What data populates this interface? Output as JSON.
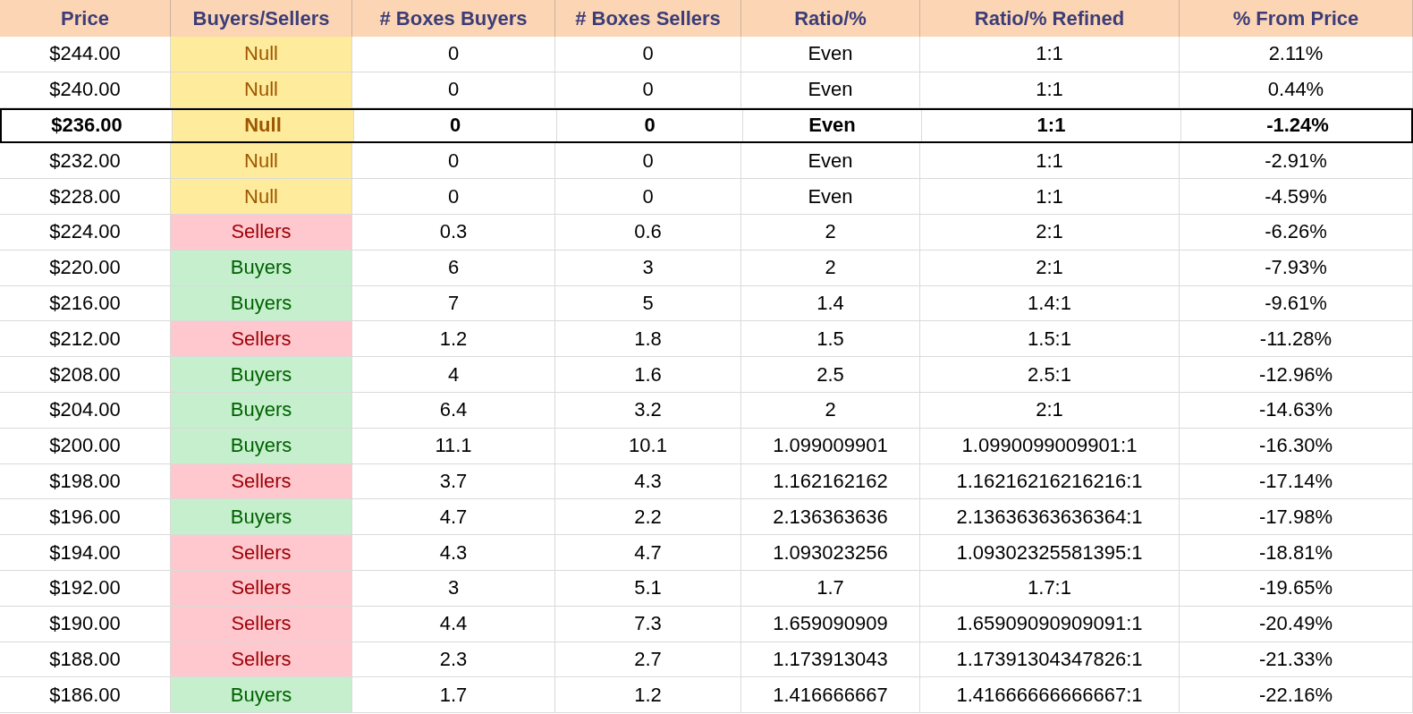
{
  "table": {
    "columns": [
      "Price",
      "Buyers/Sellers",
      "# Boxes Buyers",
      "# Boxes Sellers",
      "Ratio/%",
      "Ratio/% Refined",
      "% From Price"
    ],
    "rows": [
      {
        "price": "$244.00",
        "signal": "Null",
        "kind": "null",
        "buyers": "0",
        "sellers": "0",
        "ratio": "Even",
        "refined": "1:1",
        "from_price": "2.11%",
        "current": false
      },
      {
        "price": "$240.00",
        "signal": "Null",
        "kind": "null",
        "buyers": "0",
        "sellers": "0",
        "ratio": "Even",
        "refined": "1:1",
        "from_price": "0.44%",
        "current": false
      },
      {
        "price": "$236.00",
        "signal": "Null",
        "kind": "null",
        "buyers": "0",
        "sellers": "0",
        "ratio": "Even",
        "refined": "1:1",
        "from_price": "-1.24%",
        "current": true
      },
      {
        "price": "$232.00",
        "signal": "Null",
        "kind": "null",
        "buyers": "0",
        "sellers": "0",
        "ratio": "Even",
        "refined": "1:1",
        "from_price": "-2.91%",
        "current": false
      },
      {
        "price": "$228.00",
        "signal": "Null",
        "kind": "null",
        "buyers": "0",
        "sellers": "0",
        "ratio": "Even",
        "refined": "1:1",
        "from_price": "-4.59%",
        "current": false
      },
      {
        "price": "$224.00",
        "signal": "Sellers",
        "kind": "sellers",
        "buyers": "0.3",
        "sellers": "0.6",
        "ratio": "2",
        "refined": "2:1",
        "from_price": "-6.26%",
        "current": false
      },
      {
        "price": "$220.00",
        "signal": "Buyers",
        "kind": "buyers",
        "buyers": "6",
        "sellers": "3",
        "ratio": "2",
        "refined": "2:1",
        "from_price": "-7.93%",
        "current": false
      },
      {
        "price": "$216.00",
        "signal": "Buyers",
        "kind": "buyers",
        "buyers": "7",
        "sellers": "5",
        "ratio": "1.4",
        "refined": "1.4:1",
        "from_price": "-9.61%",
        "current": false
      },
      {
        "price": "$212.00",
        "signal": "Sellers",
        "kind": "sellers",
        "buyers": "1.2",
        "sellers": "1.8",
        "ratio": "1.5",
        "refined": "1.5:1",
        "from_price": "-11.28%",
        "current": false
      },
      {
        "price": "$208.00",
        "signal": "Buyers",
        "kind": "buyers",
        "buyers": "4",
        "sellers": "1.6",
        "ratio": "2.5",
        "refined": "2.5:1",
        "from_price": "-12.96%",
        "current": false
      },
      {
        "price": "$204.00",
        "signal": "Buyers",
        "kind": "buyers",
        "buyers": "6.4",
        "sellers": "3.2",
        "ratio": "2",
        "refined": "2:1",
        "from_price": "-14.63%",
        "current": false
      },
      {
        "price": "$200.00",
        "signal": "Buyers",
        "kind": "buyers",
        "buyers": "11.1",
        "sellers": "10.1",
        "ratio": "1.099009901",
        "refined": "1.0990099009901:1",
        "from_price": "-16.30%",
        "current": false
      },
      {
        "price": "$198.00",
        "signal": "Sellers",
        "kind": "sellers",
        "buyers": "3.7",
        "sellers": "4.3",
        "ratio": "1.162162162",
        "refined": "1.16216216216216:1",
        "from_price": "-17.14%",
        "current": false
      },
      {
        "price": "$196.00",
        "signal": "Buyers",
        "kind": "buyers",
        "buyers": "4.7",
        "sellers": "2.2",
        "ratio": "2.136363636",
        "refined": "2.13636363636364:1",
        "from_price": "-17.98%",
        "current": false
      },
      {
        "price": "$194.00",
        "signal": "Sellers",
        "kind": "sellers",
        "buyers": "4.3",
        "sellers": "4.7",
        "ratio": "1.093023256",
        "refined": "1.09302325581395:1",
        "from_price": "-18.81%",
        "current": false
      },
      {
        "price": "$192.00",
        "signal": "Sellers",
        "kind": "sellers",
        "buyers": "3",
        "sellers": "5.1",
        "ratio": "1.7",
        "refined": "1.7:1",
        "from_price": "-19.65%",
        "current": false
      },
      {
        "price": "$190.00",
        "signal": "Sellers",
        "kind": "sellers",
        "buyers": "4.4",
        "sellers": "7.3",
        "ratio": "1.659090909",
        "refined": "1.65909090909091:1",
        "from_price": "-20.49%",
        "current": false
      },
      {
        "price": "$188.00",
        "signal": "Sellers",
        "kind": "sellers",
        "buyers": "2.3",
        "sellers": "2.7",
        "ratio": "1.173913043",
        "refined": "1.17391304347826:1",
        "from_price": "-21.33%",
        "current": false
      },
      {
        "price": "$186.00",
        "signal": "Buyers",
        "kind": "buyers",
        "buyers": "1.7",
        "sellers": "1.2",
        "ratio": "1.416666667",
        "refined": "1.41666666666667:1",
        "from_price": "-22.16%",
        "current": false
      }
    ]
  }
}
